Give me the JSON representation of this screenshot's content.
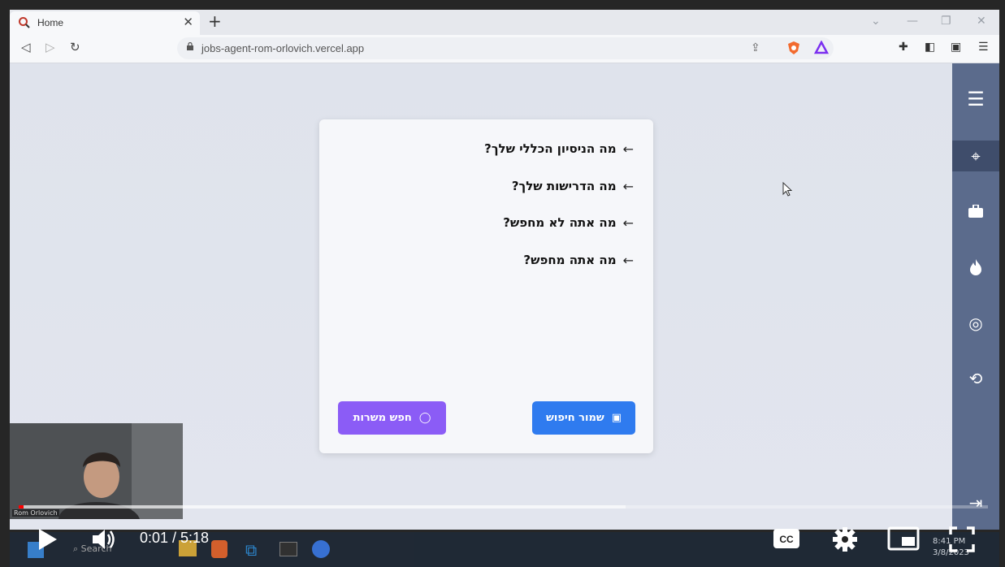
{
  "browser": {
    "tab_title": "Home",
    "url": "jobs-agent-rom-orlovich.vercel.app"
  },
  "card": {
    "questions": [
      "מה הניסיון הכללי שלך?",
      "מה הדרישות שלך?",
      "מה אתה לא מחפש?",
      "מה אתה מחפש?"
    ],
    "search_button": "חפש משרות",
    "save_button": "שמור חיפוש"
  },
  "sidebar": {
    "icons": [
      "menu-icon",
      "target-icon",
      "briefcase-icon",
      "fire-icon",
      "radar-icon",
      "history-icon",
      "logout-icon"
    ]
  },
  "video": {
    "current_time": "0:01",
    "duration": "5:18",
    "time_display": "0:01 / 5:18",
    "progress": 0.003,
    "buffered": 0.63,
    "webcam_name": "Rom Orlovich"
  },
  "taskbar": {
    "search_label": "Search",
    "clock_time": "8:41 PM",
    "clock_date": "3/8/2023"
  },
  "colors": {
    "sidebar": "#5b6b8c",
    "search_button": "#8b5cf6",
    "save_button": "#2f7bef",
    "progress": "#ff0000"
  }
}
